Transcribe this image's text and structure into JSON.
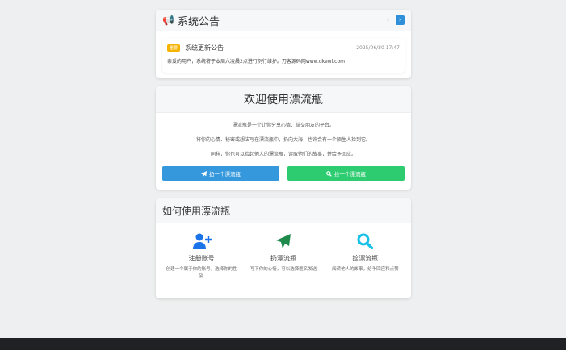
{
  "announcement": {
    "title": "系统公告",
    "badge": "重要",
    "notice_title": "系统更新公告",
    "time": "2025/06/30 17:47",
    "text": "亲爱的用户，系统将于本周六凌晨2点进行例行维护。刀客源码网www.dkewl.com",
    "prev": "‹",
    "next": "›"
  },
  "welcome": {
    "title": "欢迎使用漂流瓶",
    "lines": [
      "漂流瓶是一个让你分享心情、结交朋友的平台。",
      "将你的心情、秘密或想法写在漂流瓶中，扔向大海，也许会有一个陌生人捡到它。",
      "同样，你也可以捡起他人的漂流瓶，读取他们的故事，并给予回应。"
    ],
    "throw_label": "扔一个漂流瓶",
    "pick_label": "捡一个漂流瓶"
  },
  "howto": {
    "title": "如何使用漂流瓶",
    "steps": [
      {
        "title": "注册账号",
        "desc": "创建一个属于你的账号，选择你的性别",
        "icon": "user-plus-icon",
        "color": "#1a73e8"
      },
      {
        "title": "扔漂流瓶",
        "desc": "写下你的心情，可以选择匿名发送",
        "icon": "paper-plane-icon",
        "color": "#1e8a4c"
      },
      {
        "title": "捡漂流瓶",
        "desc": "阅读他人的故事，给予回应和点赞",
        "icon": "search-icon",
        "color": "#17c1e8"
      }
    ]
  }
}
